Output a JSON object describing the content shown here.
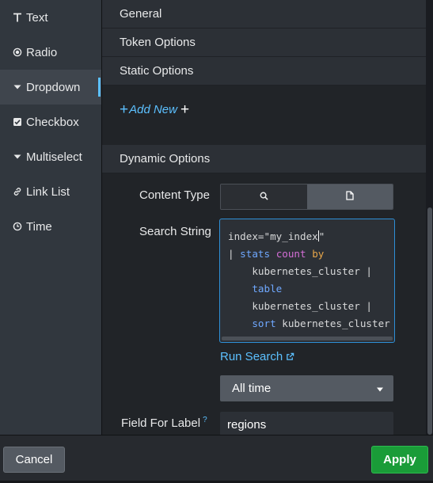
{
  "sidebar": {
    "items": [
      {
        "label": "Text",
        "icon": "text-icon",
        "active": false
      },
      {
        "label": "Radio",
        "icon": "radio-icon",
        "active": false
      },
      {
        "label": "Dropdown",
        "icon": "dropdown-caret-icon",
        "active": true
      },
      {
        "label": "Checkbox",
        "icon": "checkbox-icon",
        "active": false
      },
      {
        "label": "Multiselect",
        "icon": "multiselect-caret-icon",
        "active": false
      },
      {
        "label": "Link List",
        "icon": "link-icon",
        "active": false
      },
      {
        "label": "Time",
        "icon": "clock-icon",
        "active": false
      }
    ]
  },
  "sections": {
    "general": "General",
    "token_options": "Token Options",
    "static_options": "Static Options",
    "add_new": "Add New",
    "dynamic_options": "Dynamic Options"
  },
  "dynamic": {
    "content_type_label": "Content Type",
    "search_string_label": "Search String",
    "query_lines": [
      "index=\"my_index\"",
      "| stats count by",
      "kubernetes_cluster |",
      "table",
      "kubernetes_cluster |",
      "sort kubernetes_cluster"
    ],
    "query_tokens": {
      "index_text": "index=\"my_index",
      "index_quote": "\"",
      "pipe": "| ",
      "stats": "stats",
      "count": "count",
      "by": "by",
      "field1": "kubernetes_cluster |",
      "table": "table",
      "field2": "kubernetes_cluster |",
      "sort": "sort",
      "field3": " kubernetes_cluster"
    },
    "run_search": "Run Search",
    "time_range": "All time",
    "field_for_label": "Field For Label",
    "field_for_label_help": "?",
    "field_for_label_value": "regions"
  },
  "footer": {
    "cancel": "Cancel",
    "apply": "Apply"
  },
  "colors": {
    "accent": "#5cc0ff",
    "apply_green": "#1a9c38",
    "panel_bg": "#212428",
    "sidebar_bg": "#31373e"
  }
}
